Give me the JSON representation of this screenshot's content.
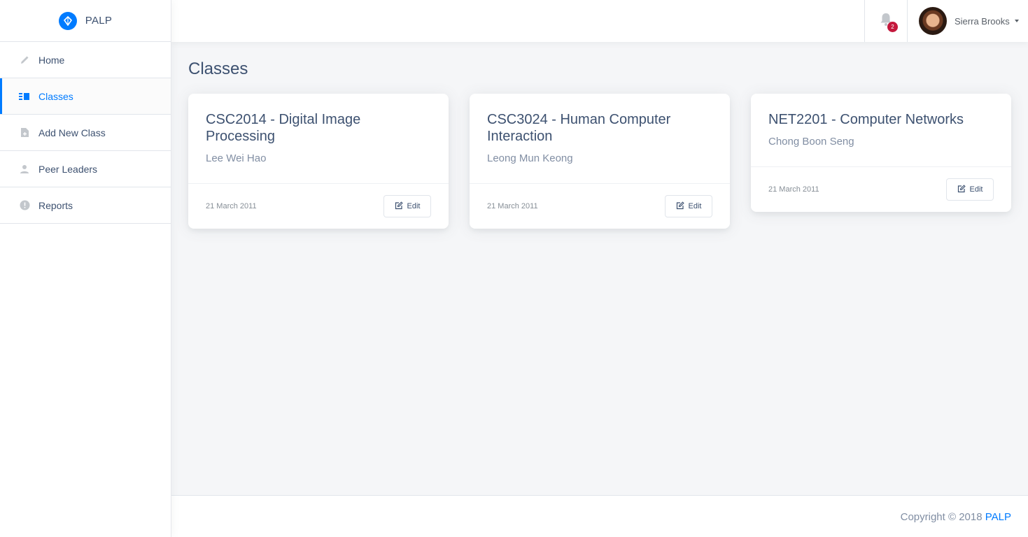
{
  "brand": {
    "name": "PALP",
    "icon": "diamond-logo-icon",
    "color": "#007bff"
  },
  "sidebar": {
    "items": [
      {
        "label": "Home",
        "icon": "pencil-icon",
        "active": false
      },
      {
        "label": "Classes",
        "icon": "view-list-icon",
        "active": true
      },
      {
        "label": "Add New Class",
        "icon": "note-add-icon",
        "active": false
      },
      {
        "label": "Peer Leaders",
        "icon": "person-icon",
        "active": false
      },
      {
        "label": "Reports",
        "icon": "error-icon",
        "active": false
      }
    ]
  },
  "header": {
    "notifications": {
      "icon": "bell-icon",
      "count": "2"
    },
    "user": {
      "name": "Sierra Brooks",
      "icon": "chevron-down-icon"
    }
  },
  "main": {
    "title": "Classes",
    "cards": [
      {
        "title": "CSC2014 - Digital Image Processing",
        "instructor": "Lee Wei Hao",
        "date": "21 March 2011",
        "edit_label": "Edit"
      },
      {
        "title": "CSC3024 - Human Computer Interaction",
        "instructor": "Leong Mun Keong",
        "date": "21 March 2011",
        "edit_label": "Edit"
      },
      {
        "title": "NET2201 - Computer Networks",
        "instructor": "Chong Boon Seng",
        "date": "21 March 2011",
        "edit_label": "Edit"
      }
    ]
  },
  "footer": {
    "copyright": "Copyright © 2018",
    "brand_link": "PALP"
  },
  "colors": {
    "accent": "#007bff",
    "text": "#3d5170",
    "muted": "#818ea3",
    "badge": "#c4183c"
  }
}
